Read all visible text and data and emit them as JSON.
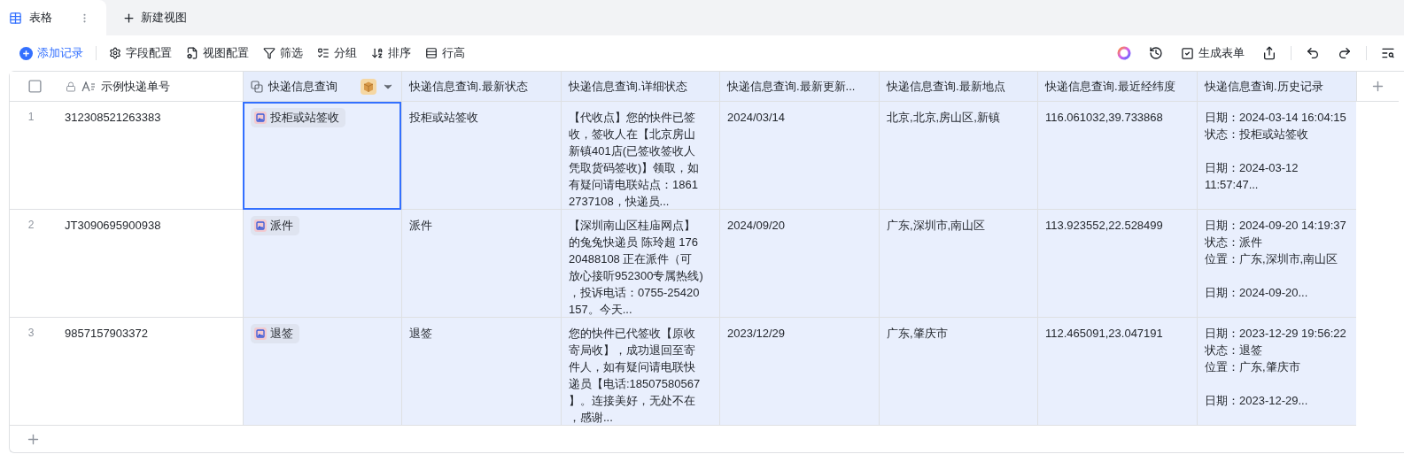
{
  "tabs": [
    {
      "label": "表格",
      "selected": true
    }
  ],
  "new_view": {
    "label": "新建视图"
  },
  "toolbar": {
    "left": [
      {
        "kind": "add",
        "label": "添加记录"
      },
      {
        "kind": "fields",
        "label": "字段配置"
      },
      {
        "kind": "view",
        "label": "视图配置"
      },
      {
        "kind": "filter",
        "label": "筛选"
      },
      {
        "kind": "group",
        "label": "分组"
      },
      {
        "kind": "sort",
        "label": "排序"
      },
      {
        "kind": "row_height",
        "label": "行高"
      }
    ],
    "right": [
      {
        "kind": "ai"
      },
      {
        "kind": "history"
      },
      {
        "kind": "form",
        "label": "生成表单"
      },
      {
        "kind": "share"
      },
      {
        "kind": "undo"
      },
      {
        "kind": "redo"
      },
      {
        "kind": "search"
      }
    ]
  },
  "table": {
    "columns": [
      {
        "label": "示例快递单号",
        "kind": "primary",
        "highlighted": false
      },
      {
        "label": "快递信息查询",
        "kind": "lookup",
        "highlighted": true
      },
      {
        "label": "快递信息查询.最新状态",
        "kind": "text",
        "highlighted": true
      },
      {
        "label": "快递信息查询.详细状态",
        "kind": "text",
        "highlighted": true
      },
      {
        "label": "快递信息查询.最新更新...",
        "kind": "text",
        "highlighted": true
      },
      {
        "label": "快递信息查询.最新地点",
        "kind": "text",
        "highlighted": true
      },
      {
        "label": "快递信息查询.最近经纬度",
        "kind": "text",
        "highlighted": true
      },
      {
        "label": "快递信息查询.历史记录",
        "kind": "text",
        "highlighted": true
      }
    ],
    "rows": [
      {
        "number": "1",
        "tracking_no": "312308521263383",
        "status_tag": {
          "label": "投柜或站签收",
          "selected": true
        },
        "values": [
          "投柜或站签收",
          "【代收点】您的快件已签收，签收人在【北京房山新镇401店(已签收签收人凭取货码签收)】领取，如有疑问请电联站点：18612737108，快递员...",
          "2024/03/14",
          "北京,北京,房山区,新镇",
          "116.061032,39.733868"
        ],
        "history": [
          [
            "日期：2024-03-14 16:04:15",
            "状态：投柜或站签收"
          ],
          [
            "日期：2024-03-12 11:57:47..."
          ]
        ]
      },
      {
        "number": "2",
        "tracking_no": "JT3090695900938",
        "status_tag": {
          "label": "派件",
          "selected": false
        },
        "values": [
          "派件",
          "【深圳南山区桂庙网点】的兔兔快递员 陈玲超 17620488108 正在派件（可放心接听952300专属热线)，投诉电话：0755-25420157。今天...",
          "2024/09/20",
          "广东,深圳市,南山区",
          "113.923552,22.528499"
        ],
        "history": [
          [
            "日期：2024-09-20 14:19:37",
            "状态：派件",
            "位置：广东,深圳市,南山区"
          ],
          [
            "日期：2024-09-20..."
          ]
        ]
      },
      {
        "number": "3",
        "tracking_no": "9857157903372",
        "status_tag": {
          "label": "退签",
          "selected": false
        },
        "values": [
          "退签",
          "您的快件已代签收【原收寄局收】，成功退回至寄件人，如有疑问请电联快递员【电话:18507580567】。连接美好，无处不在，感谢...",
          "2023/12/29",
          "广东,肇庆市",
          "112.465091,23.047191"
        ],
        "history": [
          [
            "日期：2023-12-29 19:56:22",
            "状态：退签",
            "位置：广东,肇庆市"
          ],
          [
            "日期：2023-12-29..."
          ]
        ]
      }
    ]
  }
}
